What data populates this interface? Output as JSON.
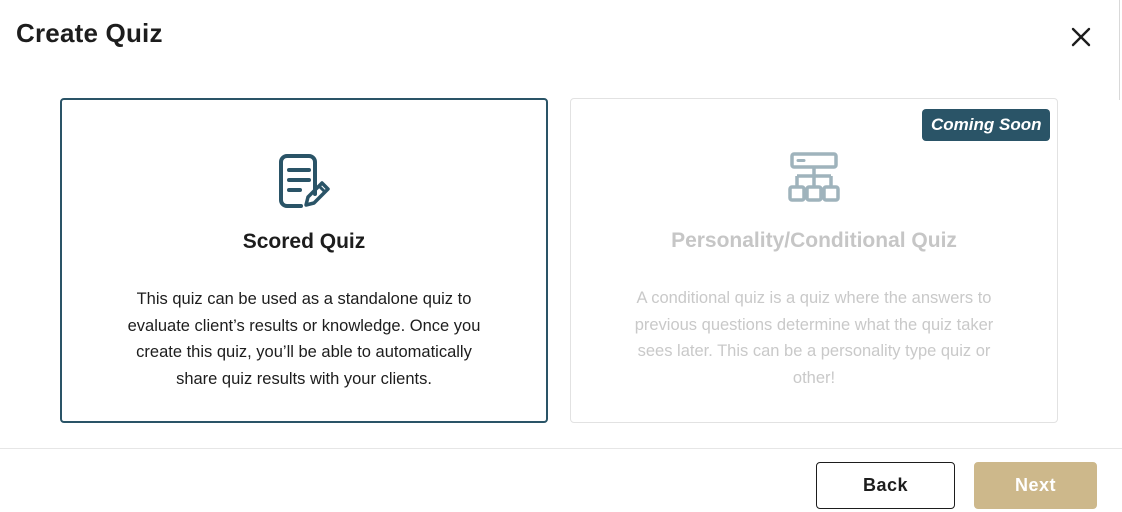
{
  "dialog": {
    "title": "Create Quiz"
  },
  "icons": {
    "close": "close-icon",
    "scored": "document-edit-icon",
    "personality": "hierarchy-tree-icon"
  },
  "cards": {
    "scored": {
      "title": "Scored Quiz",
      "description": "This quiz can be used as a standalone quiz to evaluate client’s results or knowledge. Once you create this quiz, you’ll be able to automatically share quiz results with your clients.",
      "selected": true
    },
    "personality": {
      "title": "Personality/Conditional Quiz",
      "description": "A conditional quiz is a quiz where the answers to previous questions determine what the quiz taker sees later. This can be a personality type quiz or other!",
      "badge": "Coming Soon",
      "disabled": true
    }
  },
  "footer": {
    "back_label": "Back",
    "next_label": "Next"
  },
  "colors": {
    "accent": "#2a5467",
    "next_button": "#cdb88b",
    "disabled_text": "#c6c6c6",
    "disabled_icon": "#9fb3bc"
  }
}
